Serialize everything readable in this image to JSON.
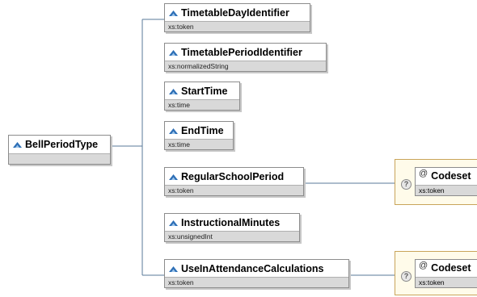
{
  "root": {
    "name": "BellPeriodType"
  },
  "elements": [
    {
      "name": "TimetableDayIdentifier",
      "type": "xs:token"
    },
    {
      "name": "TimetablePeriodIdentifier",
      "type": "xs:normalizedString"
    },
    {
      "name": "StartTime",
      "type": "xs:time"
    },
    {
      "name": "EndTime",
      "type": "xs:time"
    },
    {
      "name": "RegularSchoolPeriod",
      "type": "xs:token"
    },
    {
      "name": "InstructionalMinutes",
      "type": "xs:unsignedInt"
    },
    {
      "name": "UseInAttendanceCalculations",
      "type": "xs:token"
    }
  ],
  "attributes": [
    {
      "symbol": "@",
      "name": "Codeset",
      "type": "xs:token",
      "help": "?"
    },
    {
      "symbol": "@",
      "name": "Codeset",
      "type": "xs:token",
      "help": "?"
    }
  ],
  "colors": {
    "icon_blue": "#2d6fb6",
    "attr_border": "#c9a45a",
    "attr_fill": "#fffbea",
    "type_bar": "#d9d9d9"
  }
}
